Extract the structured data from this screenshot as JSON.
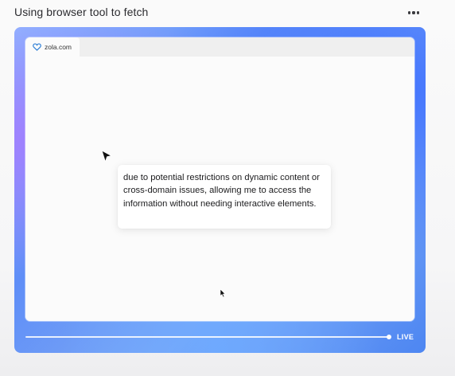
{
  "header": {
    "title": "Using browser tool to fetch",
    "more_icon": "more-horizontal-icon"
  },
  "browser": {
    "tab": {
      "label": "zola.com",
      "icon": "heart-outline-icon",
      "icon_color": "#2f7fd6"
    }
  },
  "tooltip": {
    "text": "due to potential restrictions on dynamic content or cross-domain issues, allowing me to access the information without needing interactive elements."
  },
  "player": {
    "progress": 1.0,
    "live_label": "LIVE"
  },
  "colors": {
    "frame_gradient": [
      "#8fb6ff",
      "#5f8ef7",
      "#4d86f2"
    ],
    "live_text": "#ffffff"
  }
}
